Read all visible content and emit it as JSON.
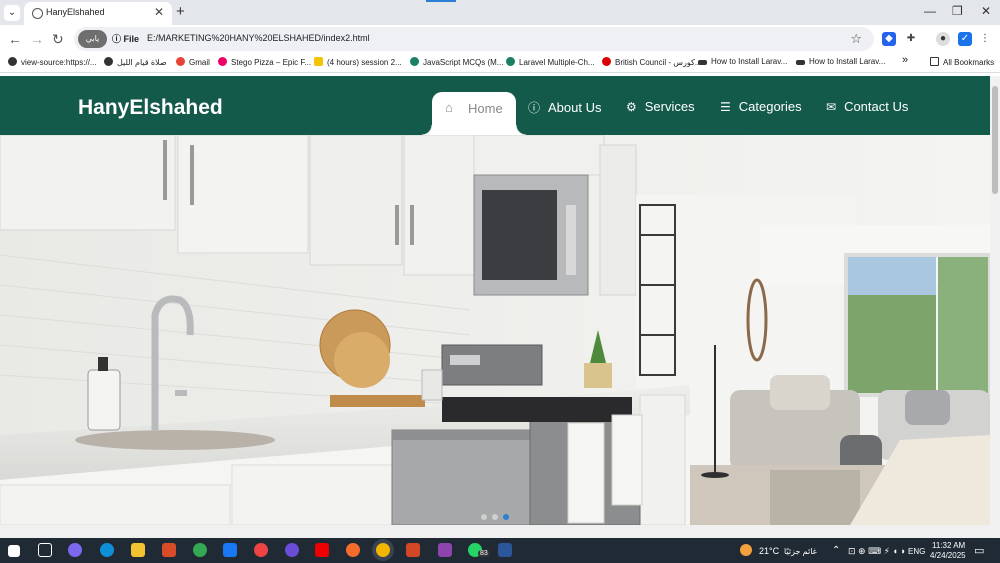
{
  "browser": {
    "tab_title": "HanyElshahed",
    "new_tab_symbol": "+",
    "close_symbol": "✕",
    "address_badge": "يابي",
    "address_scheme": "File",
    "url": "E:/MARKETING%20HANY%20ELSHAHED/index2.html",
    "window_controls": [
      "—",
      "❐",
      "✕"
    ]
  },
  "bookmarks": {
    "items": [
      {
        "label": "view-source:https://...",
        "color": "#333"
      },
      {
        "label": "صلاة قيام الليل",
        "color": "#333"
      },
      {
        "label": "Gmail",
        "color": "#ea4335"
      },
      {
        "label": "Stego Pizza – Epic F...",
        "color": "#e06"
      },
      {
        "label": "(4 hours) session 2...",
        "color": "#f5c400"
      },
      {
        "label": "JavaScript MCQs (M...",
        "color": "#1a7f64"
      },
      {
        "label": "Laravel Multiple-Ch...",
        "color": "#1a7f64"
      },
      {
        "label": "British Council - كورس...",
        "color": "#d00"
      },
      {
        "label": "How to Install Larav...",
        "color": "#333"
      },
      {
        "label": "How to Install Larav...",
        "color": "#333"
      }
    ],
    "all_bookmarks": "All Bookmarks",
    "overflow": "»"
  },
  "site": {
    "brand": "HanyElshahed",
    "nav": [
      {
        "label": "Home",
        "icon": "home-icon",
        "active": true
      },
      {
        "label": "About Us",
        "icon": "info-icon",
        "active": false
      },
      {
        "label": "Services",
        "icon": "gears-icon",
        "active": false
      },
      {
        "label": "Categories",
        "icon": "list-icon",
        "active": false
      },
      {
        "label": "Contact Us",
        "icon": "envelope-icon",
        "active": false
      }
    ],
    "colors": {
      "nav_bg": "#145a4b",
      "nav_text": "#ffffff"
    }
  },
  "taskbar": {
    "weather": "21°C",
    "weather_desc": "غائم جزئيًا",
    "language": "ENG",
    "time": "11:32 AM",
    "date": "4/24/2025",
    "whatsapp_badge": "83"
  }
}
